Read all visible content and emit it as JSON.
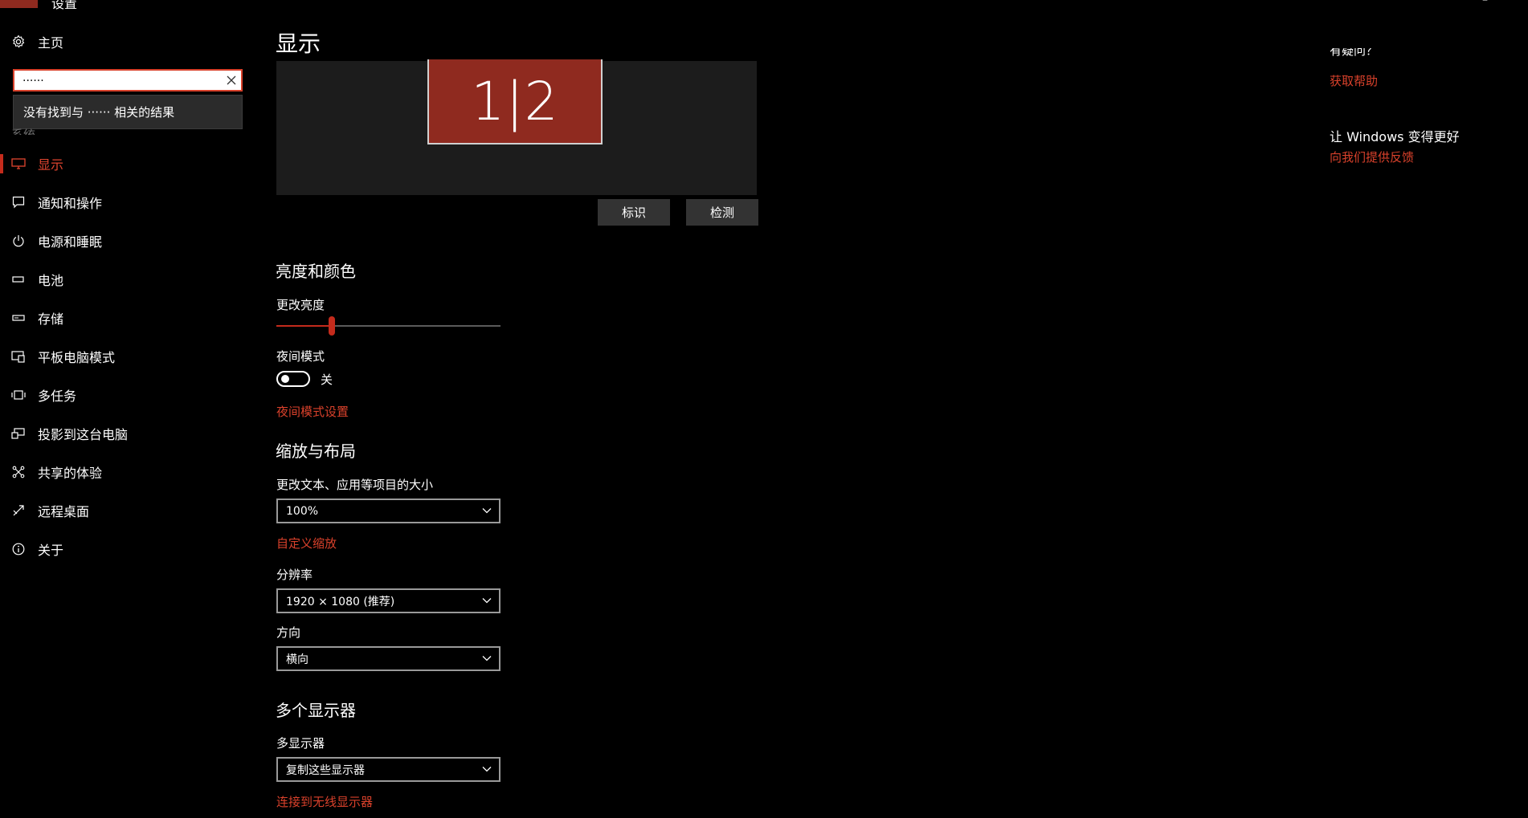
{
  "window": {
    "title_fragment": "设置"
  },
  "sidebar": {
    "home_label": "主页",
    "search": {
      "value": "······",
      "no_results": "没有找到与 ······ 相关的结果"
    },
    "section_label": "系统",
    "items": [
      {
        "label": "显示",
        "icon": "monitor-icon",
        "active": true
      },
      {
        "label": "通知和操作",
        "icon": "notification-icon",
        "active": false
      },
      {
        "label": "电源和睡眠",
        "icon": "power-icon",
        "active": false
      },
      {
        "label": "电池",
        "icon": "battery-icon",
        "active": false
      },
      {
        "label": "存储",
        "icon": "storage-icon",
        "active": false
      },
      {
        "label": "平板电脑模式",
        "icon": "tablet-mode-icon",
        "active": false
      },
      {
        "label": "多任务",
        "icon": "multitasking-icon",
        "active": false
      },
      {
        "label": "投影到这台电脑",
        "icon": "project-icon",
        "active": false
      },
      {
        "label": "共享的体验",
        "icon": "shared-experiences-icon",
        "active": false
      },
      {
        "label": "远程桌面",
        "icon": "remote-desktop-icon",
        "active": false
      },
      {
        "label": "关于",
        "icon": "info-icon",
        "active": false
      }
    ]
  },
  "main": {
    "title": "显示",
    "monitor_label": "1|2",
    "identify_button": "标识",
    "detect_button": "检测",
    "brightness": {
      "heading": "亮度和颜色",
      "slider_label": "更改亮度",
      "level_percent": 24,
      "night_mode_label": "夜间模式",
      "night_mode_state": "关",
      "night_mode_on": false,
      "night_mode_link": "夜间模式设置"
    },
    "scale": {
      "heading": "缩放与布局",
      "size_label": "更改文本、应用等项目的大小",
      "size_value": "100%",
      "custom_link": "自定义缩放",
      "resolution_label": "分辨率",
      "resolution_value": "1920 × 1080 (推荐)",
      "orientation_label": "方向",
      "orientation_value": "横向"
    },
    "multi": {
      "heading": "多个显示器",
      "label": "多显示器",
      "value": "复制这些显示器",
      "wireless_link": "连接到无线显示器"
    }
  },
  "right": {
    "question_peek": "有疑问？",
    "help_link": "获取帮助",
    "feedback_heading": "让 Windows 变得更好",
    "feedback_link": "向我们提供反馈"
  },
  "colors": {
    "accent": "#c42b1c",
    "accent_text": "#d9412b",
    "monitor_fill": "#8f2a1f",
    "background": "#000000"
  }
}
